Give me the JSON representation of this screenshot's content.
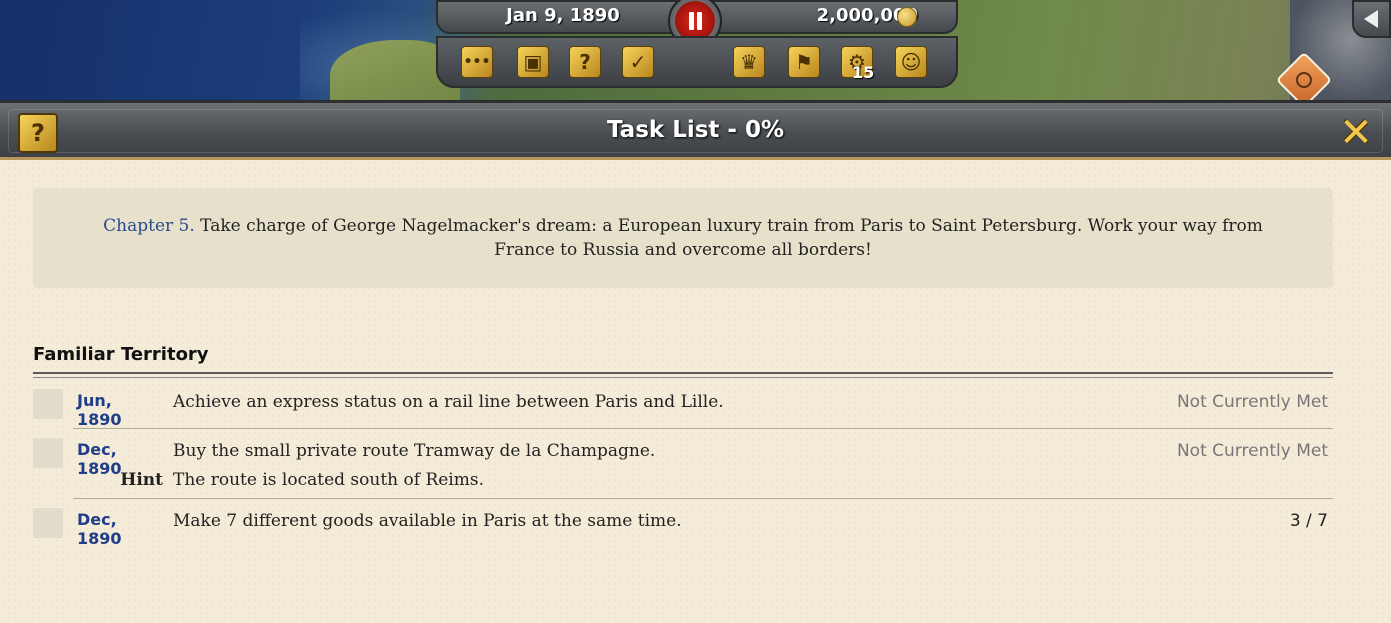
{
  "hud": {
    "date": "Jan 9, 1890",
    "money": "2,000,000",
    "buttons": [
      {
        "name": "more-options-icon",
        "glyph": "•••"
      },
      {
        "name": "monitors-icon",
        "glyph": "▣"
      },
      {
        "name": "help-icon",
        "glyph": "?"
      },
      {
        "name": "task-check-icon",
        "glyph": "✓"
      },
      {
        "name": "top-hat-icon",
        "glyph": "♛"
      },
      {
        "name": "factory-stars-icon",
        "glyph": "⚑"
      },
      {
        "name": "train-wheel-icon",
        "glyph": "⚙"
      },
      {
        "name": "people-icon",
        "glyph": "☺"
      }
    ],
    "wheel_badge": "15"
  },
  "panel": {
    "title": "Task List - 0%",
    "intro": {
      "chapter": "Chapter 5.",
      "text": "Take charge of George Nagelmacker's dream: a European luxury train from Paris to Saint Petersburg. Work your way from France to Russia and overcome all borders!"
    },
    "section": {
      "title": "Familiar Territory",
      "tasks": [
        {
          "date": "Jun, 1890",
          "desc": "Achieve an express status on a rail line between Paris and Lille.",
          "status": "Not Currently Met"
        },
        {
          "date": "Dec, 1890",
          "desc": "Buy the small private route Tramway de la Champagne.",
          "status": "Not Currently Met",
          "hint_label": "Hint",
          "hint": "The route is located south of Reims."
        },
        {
          "date": "Dec, 1890",
          "desc": "Make 7 different goods available in Paris at the same time.",
          "status": "3 / 7"
        }
      ]
    }
  },
  "colors": {
    "panel_bg": "#f4ecd9",
    "date_blue": "#1f3d8a",
    "chapter_blue": "#2b4a8c",
    "gold": "#f1c64d",
    "pause_red": "#e0281c"
  }
}
